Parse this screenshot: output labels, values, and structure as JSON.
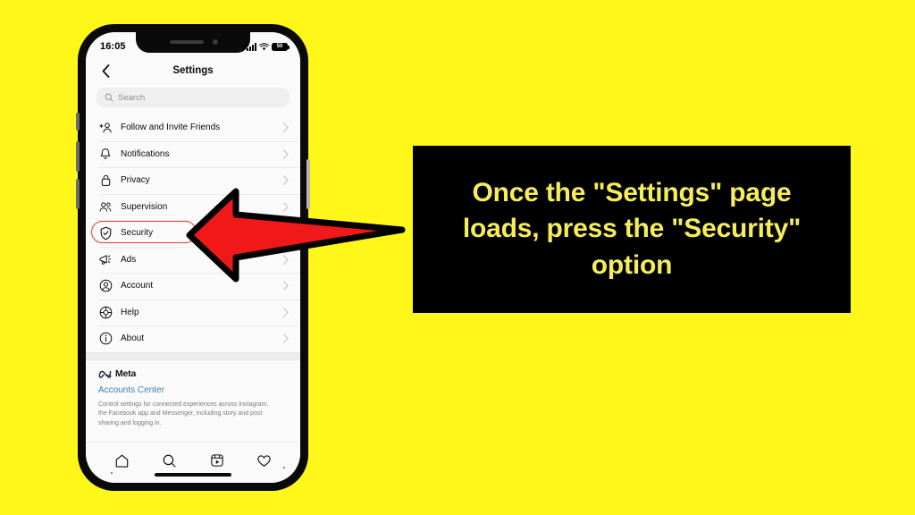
{
  "background_color": "#FFF61A",
  "phone": {
    "status_bar": {
      "time": "16:05",
      "signal_icon": "signal-bars-icon",
      "wifi_icon": "wifi-icon",
      "battery_icon": "battery-icon",
      "battery_level": "50"
    },
    "header": {
      "back_icon": "chevron-left-icon",
      "title": "Settings"
    },
    "search": {
      "icon": "search-icon",
      "placeholder": "Search",
      "value": ""
    },
    "settings_items": [
      {
        "label": "Follow and Invite Friends",
        "icon": "person-add-icon",
        "chevron": "chevron-right-icon",
        "highlighted": false
      },
      {
        "label": "Notifications",
        "icon": "bell-icon",
        "chevron": "chevron-right-icon",
        "highlighted": false
      },
      {
        "label": "Privacy",
        "icon": "lock-icon",
        "chevron": "chevron-right-icon",
        "highlighted": false
      },
      {
        "label": "Supervision",
        "icon": "people-icon",
        "chevron": "chevron-right-icon",
        "highlighted": false
      },
      {
        "label": "Security",
        "icon": "shield-check-icon",
        "chevron": "chevron-right-icon",
        "highlighted": true
      },
      {
        "label": "Ads",
        "icon": "megaphone-icon",
        "chevron": "chevron-right-icon",
        "highlighted": false
      },
      {
        "label": "Account",
        "icon": "user-circle-icon",
        "chevron": "chevron-right-icon",
        "highlighted": false
      },
      {
        "label": "Help",
        "icon": "lifebuoy-icon",
        "chevron": "chevron-right-icon",
        "highlighted": false
      },
      {
        "label": "About",
        "icon": "info-circle-icon",
        "chevron": "chevron-right-icon",
        "highlighted": false
      }
    ],
    "meta_section": {
      "brand_icon": "meta-infinity-icon",
      "brand_name": "Meta",
      "link_label": "Accounts Center",
      "link_color": "#3f7fb5",
      "description": "Control settings for connected experiences across Instagram, the Facebook app and Messenger, including story and post sharing and logging in."
    },
    "tab_bar": [
      {
        "icon": "home-icon",
        "label": "Home"
      },
      {
        "icon": "search-icon",
        "label": "Search"
      },
      {
        "icon": "reels-icon",
        "label": "Reels"
      },
      {
        "icon": "heart-icon",
        "label": "Activity"
      }
    ],
    "home_indicator": "home-indicator"
  },
  "annotation": {
    "arrow": {
      "name": "red-pointer-arrow",
      "direction": "left",
      "fill_color": "#F01818",
      "stroke_color": "#000000",
      "points_at": "Security"
    },
    "highlight": {
      "name": "security-row-highlight",
      "color": "#e5353a",
      "shape": "rounded-rectangle"
    },
    "caption": {
      "text": "Once the \"Settings\" page loads, press the \"Security\" option",
      "text_color": "#F5EE5A",
      "background_color": "#000000"
    }
  }
}
